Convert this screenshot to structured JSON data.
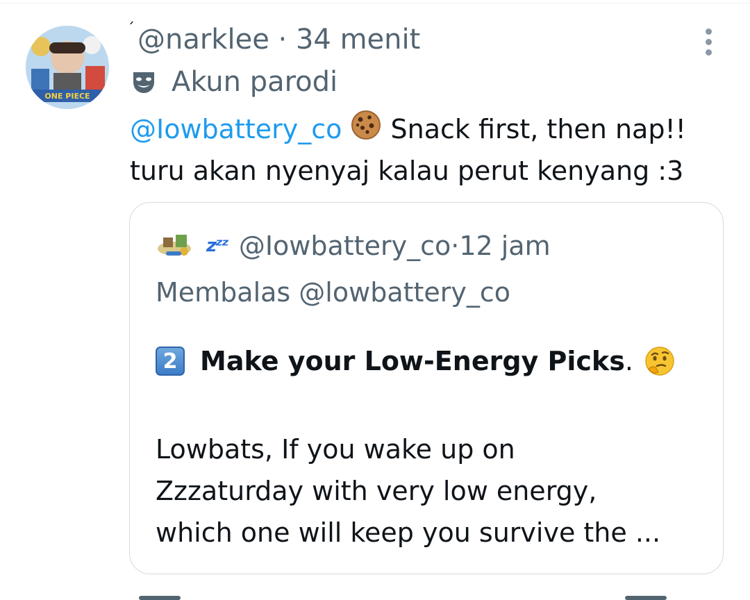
{
  "tweet": {
    "mark": "ˊ",
    "handle": "@narklee",
    "separator": " · ",
    "time": "34 menit",
    "parody_label": "Akun parodi",
    "mention": "@Iowbattery_co",
    "text_after_mention": " Snack first, then nap!!",
    "text_line2": "turu akan nyenyaj kalau perut kenyang :3"
  },
  "quote": {
    "zzz": "zᶻᶻ",
    "handle": "@Iowbattery_co",
    "separator": " · ",
    "time": "12 jam",
    "replying_to": "Membalas @lowbattery_co",
    "keycap_number": "2",
    "title": "Make your Low-Energy Picks",
    "title_tail": ".",
    "body_lines": [
      "Lowbats, If you wake up on",
      "Zzzaturday with very low energy,",
      "which one will keep you survive the ..."
    ]
  },
  "icons": {
    "avatar": "profile-avatar-icon",
    "parody": "parody-mask-icon",
    "more": "more-options-icon",
    "cookie": "cookie-emoji-icon",
    "thinking": "thinking-face-emoji-icon",
    "keycap": "keycap-2-emoji-icon",
    "zzz": "zzz-emoji-icon"
  },
  "colors": {
    "mention_blue": "#1d9bf0",
    "secondary_text": "#536471",
    "primary_text": "#0f1419",
    "card_border": "#d4dbe0"
  }
}
